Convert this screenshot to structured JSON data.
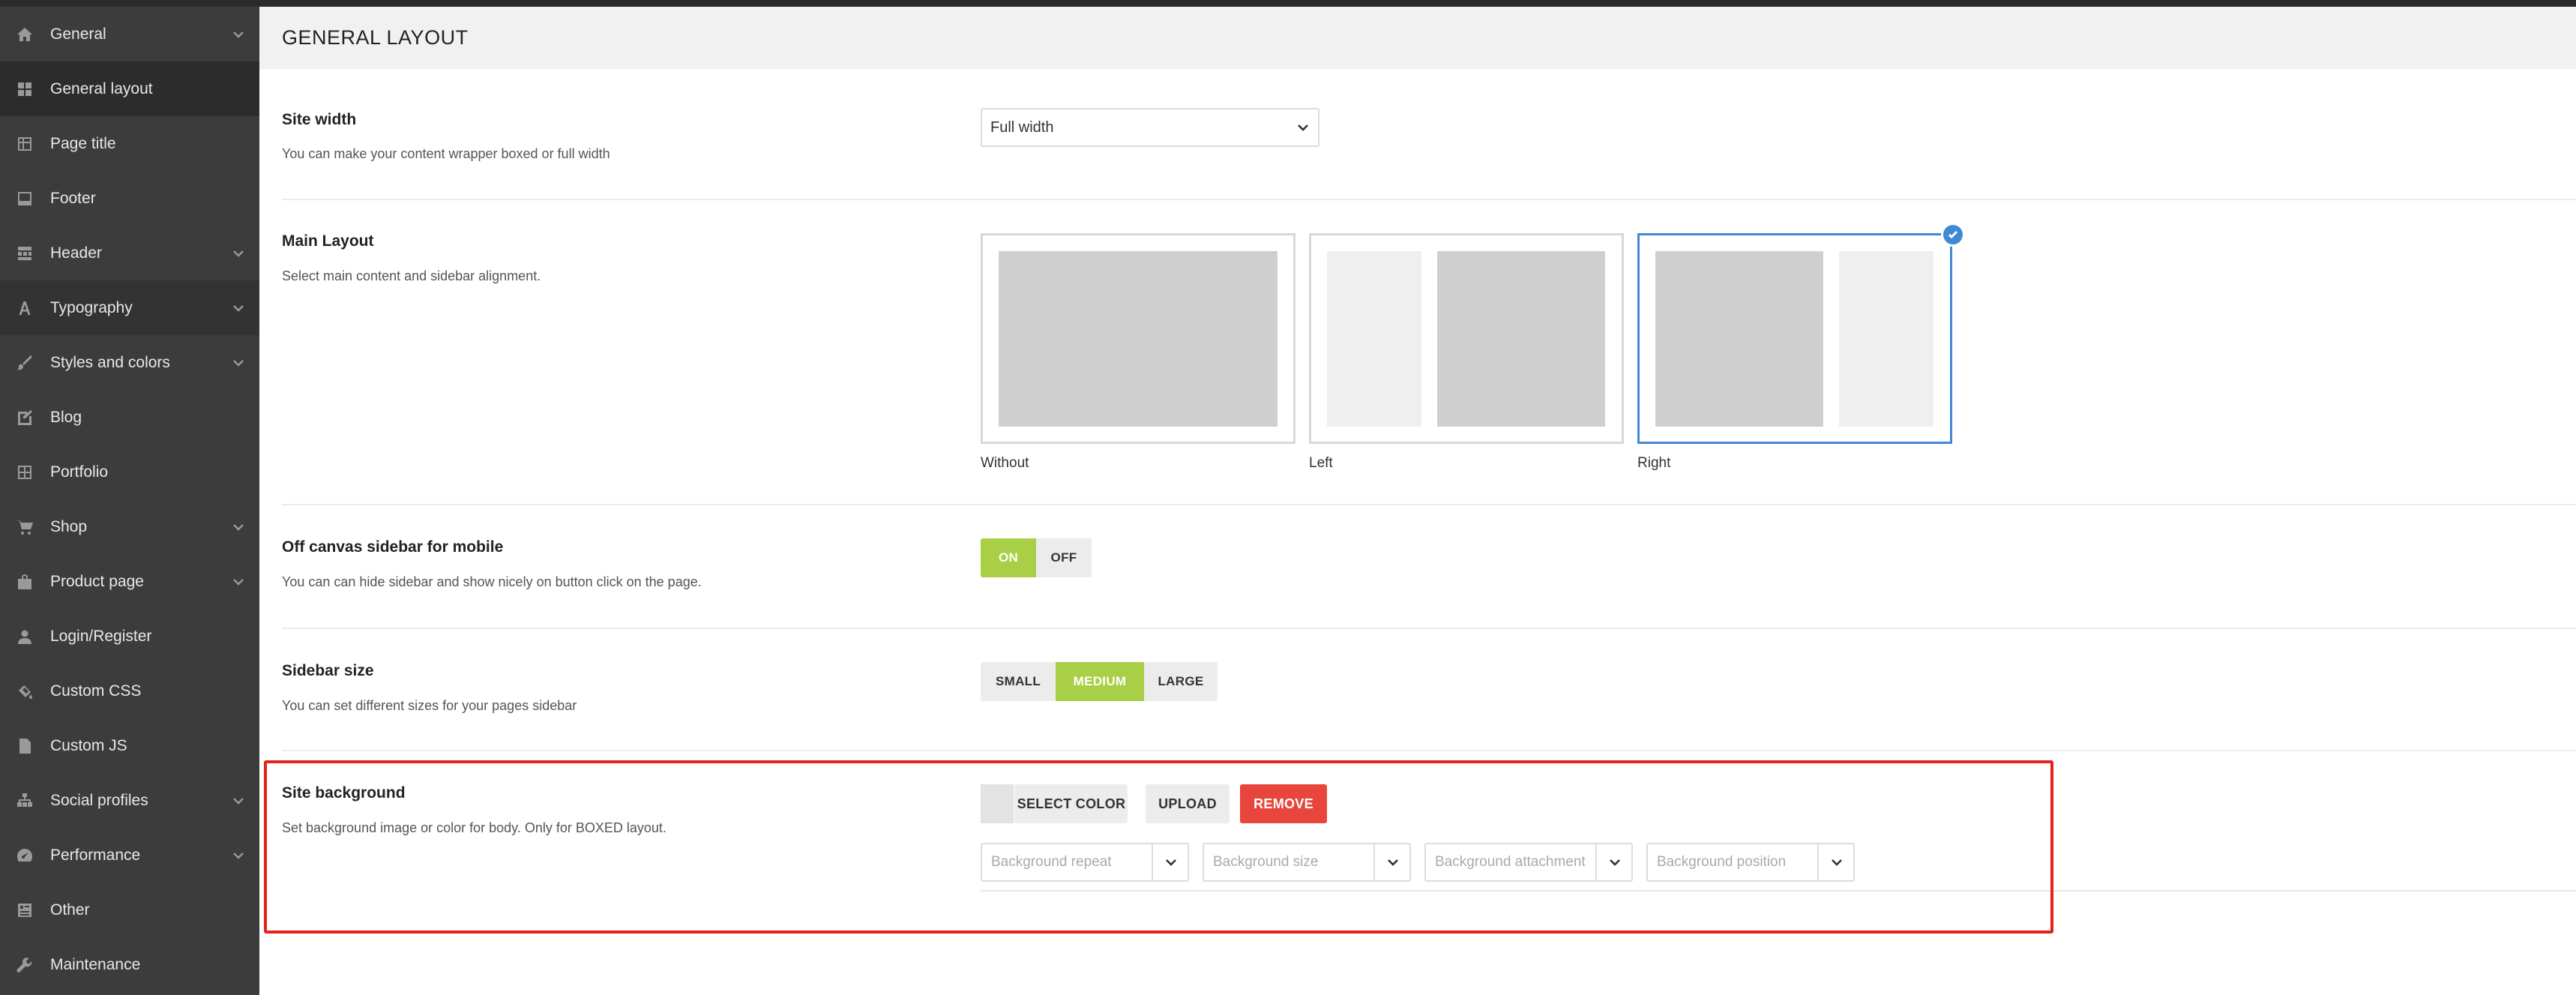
{
  "sidebar": {
    "items": [
      {
        "label": "General",
        "icon": "home-icon",
        "has_children": true
      },
      {
        "label": "General layout",
        "icon": "grid-icon",
        "has_children": false
      },
      {
        "label": "Page title",
        "icon": "table-icon",
        "has_children": false
      },
      {
        "label": "Footer",
        "icon": "footer-icon",
        "has_children": false
      },
      {
        "label": "Header",
        "icon": "header-grid-icon",
        "has_children": true
      },
      {
        "label": "Typography",
        "icon": "font-icon",
        "has_children": true
      },
      {
        "label": "Styles and colors",
        "icon": "brush-icon",
        "has_children": true
      },
      {
        "label": "Blog",
        "icon": "edit-icon",
        "has_children": false
      },
      {
        "label": "Portfolio",
        "icon": "portfolio-grid-icon",
        "has_children": false
      },
      {
        "label": "Shop",
        "icon": "cart-icon",
        "has_children": true
      },
      {
        "label": "Product page",
        "icon": "bag-icon",
        "has_children": true
      },
      {
        "label": "Login/Register",
        "icon": "user-icon",
        "has_children": false
      },
      {
        "label": "Custom CSS",
        "icon": "paint-icon",
        "has_children": false
      },
      {
        "label": "Custom JS",
        "icon": "file-icon",
        "has_children": false
      },
      {
        "label": "Social profiles",
        "icon": "sitemap-icon",
        "has_children": true
      },
      {
        "label": "Performance",
        "icon": "dashboard-icon",
        "has_children": true
      },
      {
        "label": "Other",
        "icon": "list-icon",
        "has_children": false
      },
      {
        "label": "Maintenance",
        "icon": "wrench-icon",
        "has_children": false
      }
    ],
    "active_label": "General layout"
  },
  "page": {
    "title": "GENERAL LAYOUT"
  },
  "site_width": {
    "title": "Site width",
    "description": "You can make your content wrapper boxed or full width",
    "selected": "Full width"
  },
  "main_layout": {
    "title": "Main Layout",
    "description": "Select main content and sidebar alignment.",
    "options": [
      {
        "label": "Without"
      },
      {
        "label": "Left"
      },
      {
        "label": "Right"
      }
    ],
    "selected": "Right"
  },
  "off_canvas": {
    "title": "Off canvas sidebar for mobile",
    "description": "You can can hide sidebar and show nicely on button click on the page.",
    "on_label": "ON",
    "off_label": "OFF",
    "value": "ON"
  },
  "sidebar_size": {
    "title": "Sidebar size",
    "description": "You can set different sizes for your pages sidebar",
    "options": [
      "SMALL",
      "MEDIUM",
      "LARGE"
    ],
    "selected": "MEDIUM"
  },
  "site_background": {
    "title": "Site background",
    "description": "Set background image or color for body. Only for BOXED layout.",
    "select_color_label": "SELECT COLOR",
    "upload_label": "UPLOAD",
    "remove_label": "REMOVE",
    "repeat_placeholder": "Background repeat",
    "size_placeholder": "Background size",
    "attachment_placeholder": "Background attachment",
    "position_placeholder": "Background position"
  },
  "colors": {
    "sidebar_bg": "#3c3c3c",
    "accent_blue": "#3f8ad2",
    "accent_green": "#a8cf45",
    "remove_red": "#e8453c",
    "highlight_red": "#e2231a"
  }
}
